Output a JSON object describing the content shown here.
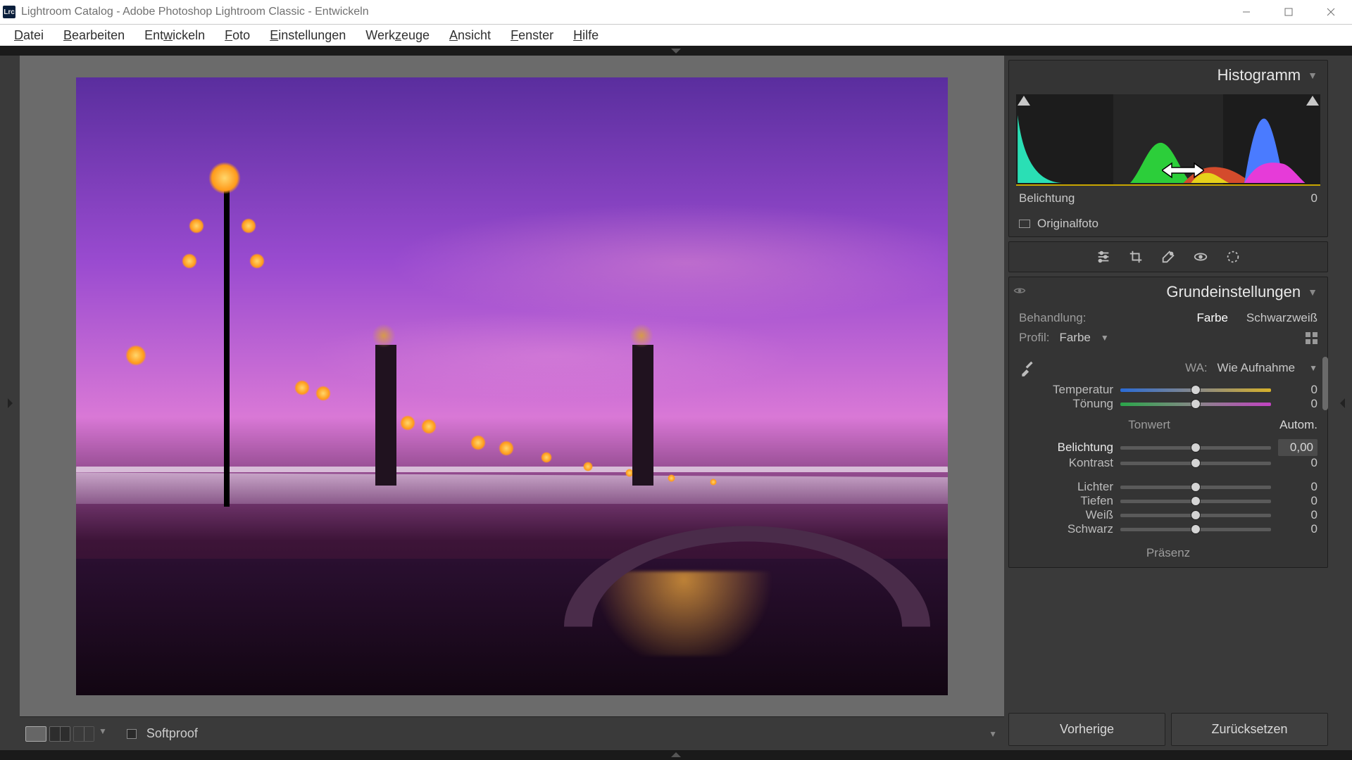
{
  "titlebar": {
    "title": "Lightroom Catalog - Adobe Photoshop Lightroom Classic - Entwickeln",
    "app_abbr": "Lrc"
  },
  "menubar": {
    "items": [
      "Datei",
      "Bearbeiten",
      "Entwickeln",
      "Foto",
      "Einstellungen",
      "Werkzeuge",
      "Ansicht",
      "Fenster",
      "Hilfe"
    ],
    "accel": [
      "D",
      "B",
      "w",
      "F",
      "E",
      "z",
      "A",
      "F",
      "H"
    ]
  },
  "right": {
    "histogram": {
      "title": "Histogramm",
      "hover_label": "Belichtung",
      "hover_value": "0",
      "original_label": "Originalfoto"
    },
    "tools": {
      "names": [
        "edit-sliders-icon",
        "crop-icon",
        "heal-brush-icon",
        "redeye-icon",
        "radial-mask-icon"
      ]
    },
    "basic": {
      "title": "Grundeinstellungen",
      "treatment_label": "Behandlung:",
      "treatment_options": [
        "Farbe",
        "Schwarzweiß"
      ],
      "treatment_active": "Farbe",
      "profile_label": "Profil:",
      "profile_value": "Farbe",
      "wb_label": "WA:",
      "wb_value": "Wie Aufnahme",
      "sliders_wb": [
        {
          "label": "Temperatur",
          "value": "0",
          "track": "track-temp"
        },
        {
          "label": "Tönung",
          "value": "0",
          "track": "track-tint"
        }
      ],
      "tone_label": "Tonwert",
      "auto_label": "Autom.",
      "sliders_tone": [
        {
          "label": "Belichtung",
          "value": "0,00",
          "hi": true,
          "boxed": true
        },
        {
          "label": "Kontrast",
          "value": "0"
        },
        {
          "label": "Lichter",
          "value": "0"
        },
        {
          "label": "Tiefen",
          "value": "0"
        },
        {
          "label": "Weiß",
          "value": "0"
        },
        {
          "label": "Schwarz",
          "value": "0"
        }
      ],
      "presence_label": "Präsenz"
    },
    "buttons": {
      "prev": "Vorherige",
      "reset": "Zurücksetzen"
    }
  },
  "toolbar": {
    "softproof": "Softproof"
  }
}
